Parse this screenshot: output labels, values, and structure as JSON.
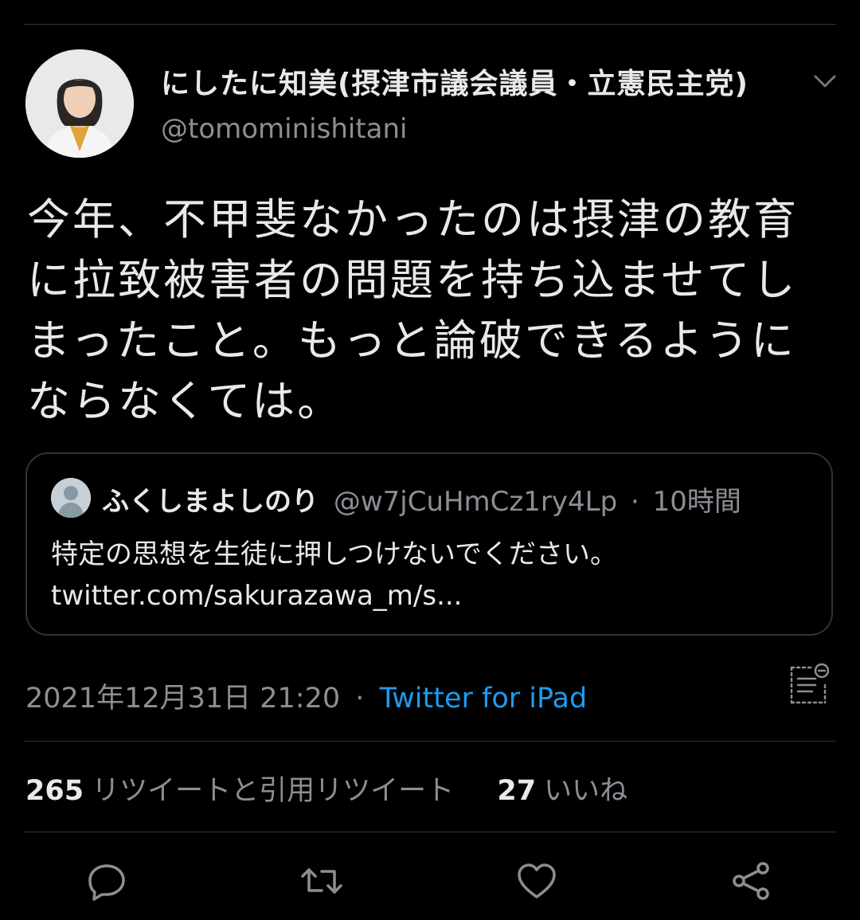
{
  "tweet": {
    "author": {
      "display_name": "にしたに知美(摂津市議会議員・立憲民主党)",
      "handle": "@tomominishitani"
    },
    "text": "今年、不甲斐なかったのは摂津の教育に拉致被害者の問題を持ち込ませてしまったこと。もっと論破できるようにならなくては。",
    "quote": {
      "name": "ふくしまよしのり",
      "handle": "@w7jCuHmCz1ry4Lp",
      "separator": "·",
      "time": "10時間",
      "text": "特定の思想を生徒に押しつけないでください。",
      "link": "twitter.com/sakurazawa_m/s..."
    },
    "timestamp": "2021年12月31日 21:20",
    "separator": "·",
    "source": "Twitter for iPad",
    "stats": {
      "retweets_count": "265",
      "retweets_label": "リツイートと引用リツイート",
      "likes_count": "27",
      "likes_label": "いいね"
    }
  },
  "icons": {
    "more": "chevron-down-icon",
    "translate": "translate-icon",
    "reply": "reply-icon",
    "retweet": "retweet-icon",
    "like": "heart-icon",
    "share": "share-icon"
  },
  "colors": {
    "background": "#000000",
    "text": "#e7e9ea",
    "secondary": "#8b8f94",
    "link": "#1d9bf0",
    "border": "#2f3336"
  }
}
